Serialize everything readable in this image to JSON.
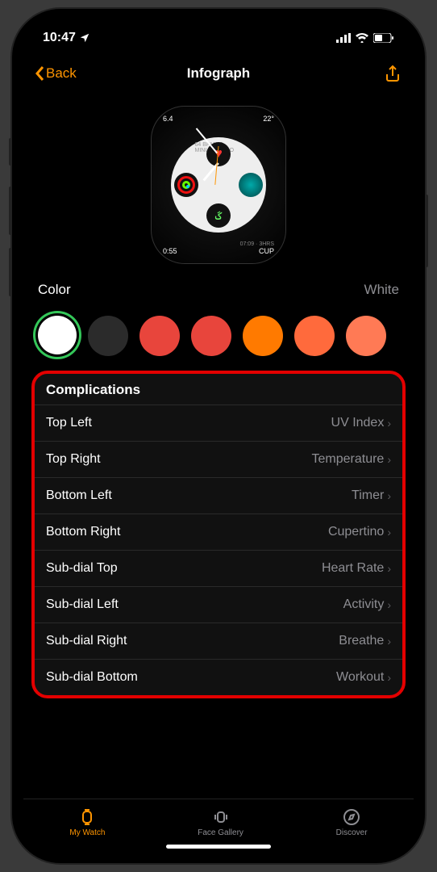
{
  "status": {
    "time": "10:47",
    "location_icon": "◤"
  },
  "nav": {
    "back": "Back",
    "title": "Infograph"
  },
  "watch_face": {
    "top_left_value": "6.4",
    "top_right_value": "22°",
    "bpm_text": "64 BPM",
    "minutes_text": "3 MINUTES AGO",
    "bottom_left_time": "0:55",
    "bottom_right_label": "CUP",
    "bottom_right_time": "07:09 · 3HRS"
  },
  "color": {
    "label": "Color",
    "value": "White"
  },
  "colors": [
    "#ffffff",
    "#2b2b2b",
    "#e8453c",
    "#e8453c",
    "#ff7a00",
    "#ff6a3c",
    "#ff7a55"
  ],
  "complications": {
    "header": "Complications",
    "rows": [
      {
        "label": "Top Left",
        "value": "UV Index"
      },
      {
        "label": "Top Right",
        "value": "Temperature"
      },
      {
        "label": "Bottom Left",
        "value": "Timer"
      },
      {
        "label": "Bottom Right",
        "value": "Cupertino"
      },
      {
        "label": "Sub-dial Top",
        "value": "Heart Rate"
      },
      {
        "label": "Sub-dial Left",
        "value": "Activity"
      },
      {
        "label": "Sub-dial Right",
        "value": "Breathe"
      },
      {
        "label": "Sub-dial Bottom",
        "value": "Workout"
      }
    ]
  },
  "tabs": [
    {
      "label": "My Watch",
      "active": true
    },
    {
      "label": "Face Gallery",
      "active": false
    },
    {
      "label": "Discover",
      "active": false
    }
  ]
}
